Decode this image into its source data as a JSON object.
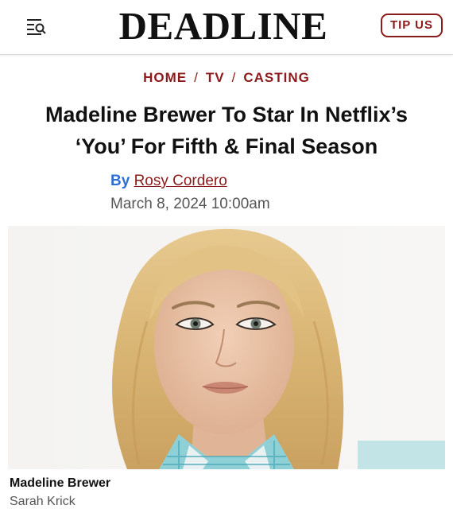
{
  "header": {
    "logo": "DEADLINE",
    "tip_label": "TIP US"
  },
  "breadcrumb": {
    "items": [
      "HOME",
      "TV",
      "CASTING"
    ],
    "separator": "/"
  },
  "article": {
    "headline_line1": "Madeline Brewer To Star In Netflix’s",
    "headline_line2": "‘You’ For Fifth & Final Season",
    "by_label": "By",
    "author": "Rosy Cordero",
    "date": "March 8, 2024 10:00am"
  },
  "photo": {
    "caption": "Madeline Brewer",
    "credit": "Sarah Krick"
  },
  "colors": {
    "accent": "#8d1a1a",
    "byline_blue": "#2d6fd6",
    "muted_text": "#555555"
  },
  "icons": {
    "menu": "menu-search-icon"
  }
}
